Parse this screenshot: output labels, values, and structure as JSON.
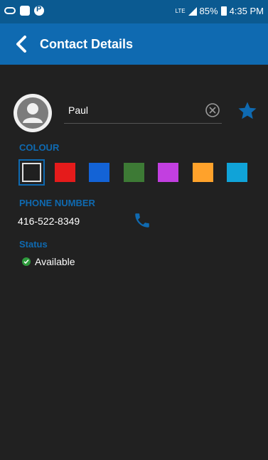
{
  "status_bar": {
    "network_type": "LTE",
    "battery": "85%",
    "time": "4:35 PM"
  },
  "app_bar": {
    "title": "Contact Details",
    "back_icon": "chevron-left-icon"
  },
  "contact": {
    "avatar_icon": "person-icon",
    "name": "Paul",
    "clear_icon": "clear-circle-icon",
    "favorite_icon": "star-icon"
  },
  "colour": {
    "label": "COLOUR",
    "swatches": [
      "#202020",
      "#e51b1b",
      "#1363d6",
      "#3d7a35",
      "#c23fe0",
      "#ffa22b",
      "#10a3d8"
    ],
    "selected_index": 0
  },
  "phone": {
    "label": "PHONE NUMBER",
    "number": "416-522-8349",
    "call_icon": "phone-icon"
  },
  "status": {
    "label": "Status",
    "value": "Available",
    "icon": "check-circle-icon",
    "color": "#2e9a3c"
  },
  "colors": {
    "accent": "#0f6ab1",
    "status_bar": "#0b5a91",
    "background": "#212121"
  }
}
